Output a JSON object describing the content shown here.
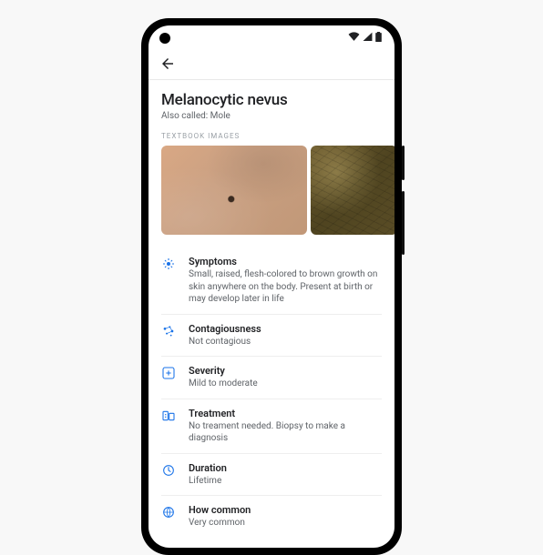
{
  "header": {
    "title": "Melanocytic nevus",
    "subtitle": "Also called: Mole",
    "section_label": "TEXTBOOK IMAGES"
  },
  "items": [
    {
      "icon": "symptoms",
      "title": "Symptoms",
      "desc": "Small, raised, flesh-colored to brown growth on skin anywhere on the body. Present at birth or may develop later in life"
    },
    {
      "icon": "contagious",
      "title": "Contagiousness",
      "desc": "Not contagious"
    },
    {
      "icon": "severity",
      "title": "Severity",
      "desc": "Mild to moderate"
    },
    {
      "icon": "treatment",
      "title": "Treatment",
      "desc": "No treament needed. Biopsy to make a diagnosis"
    },
    {
      "icon": "duration",
      "title": "Duration",
      "desc": "Lifetime"
    },
    {
      "icon": "common",
      "title": "How common",
      "desc": "Very common"
    }
  ],
  "colors": {
    "accent": "#1a73e8"
  }
}
